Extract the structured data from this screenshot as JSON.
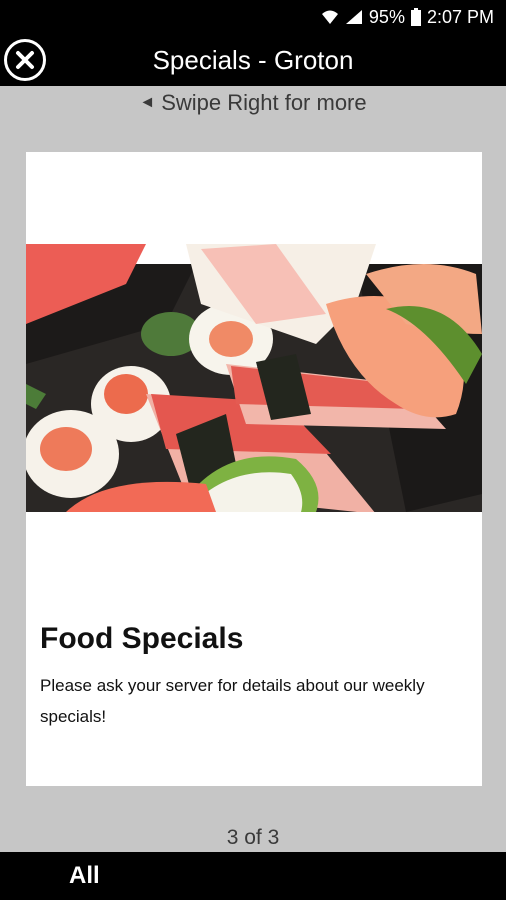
{
  "status_bar": {
    "battery": "95%",
    "time": "2:07 PM",
    "icons": [
      "wifi-icon",
      "signal-icon",
      "battery-icon"
    ]
  },
  "header": {
    "title": "Specials - Groton",
    "close_icon": "close-icon"
  },
  "swipe_hint": {
    "arrow": "◄",
    "text": "Swipe Right for more"
  },
  "card": {
    "image": "sushi-platter-image",
    "title": "Food Specials",
    "body": "Please ask your server for details about our weekly specials!"
  },
  "pager": {
    "text": "3 of 3"
  },
  "bottom_tabs": {
    "all_label": "All"
  },
  "colors": {
    "bar_background": "#000000",
    "page_background": "#c6c6c6",
    "card_background": "#ffffff"
  }
}
